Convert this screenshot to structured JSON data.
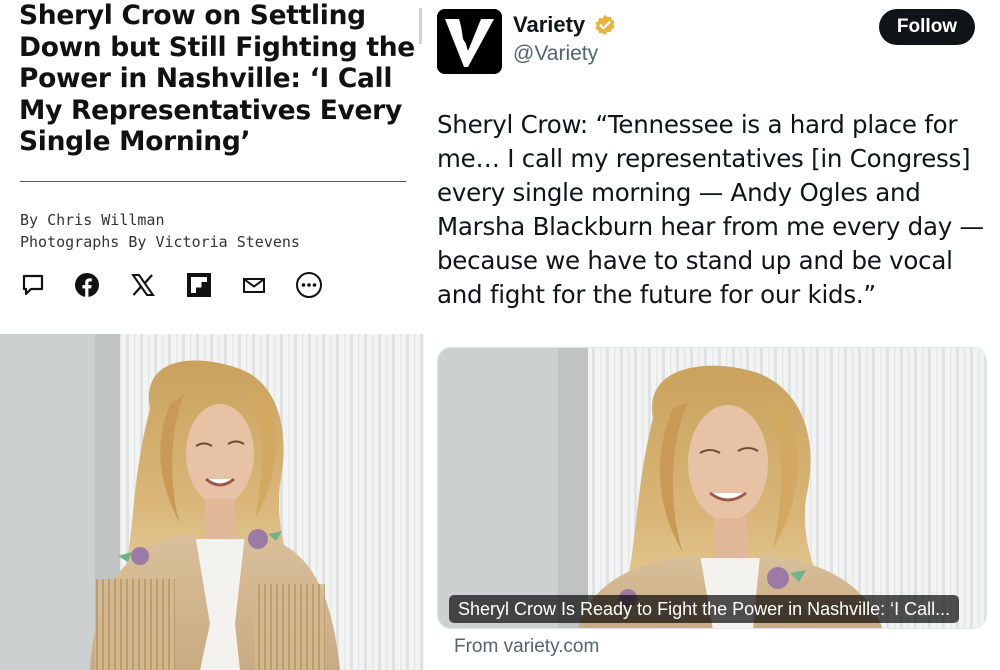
{
  "article": {
    "headline": "Sheryl Crow on Settling Down but Still Fighting the Power in Nashville: ‘I Call My Representatives Every Single Morning’",
    "byline_author": "By Chris Willman",
    "byline_photos": "Photographs By Victoria Stevens",
    "share_icons": [
      "comment-icon",
      "facebook-icon",
      "x-icon",
      "flipboard-icon",
      "email-icon",
      "more-icon"
    ]
  },
  "tweet": {
    "account_name": "Variety",
    "handle": "@Variety",
    "follow_label": "Follow",
    "text": "Sheryl Crow: “Tennessee is a hard place for me… I call my representatives [in Congress] every single morning — Andy Ogles and Marsha Blackburn hear from me every day — because we have to stand up and be vocal and fight for the future for our kids.”",
    "card_title": "Sheryl Crow Is Ready to Fight the Power in Nashville: ‘I Call...",
    "card_source": "From variety.com"
  },
  "colors": {
    "follow_bg": "#0f1419",
    "verified_gold": "#e8b33b",
    "handle_gray": "#536471"
  }
}
